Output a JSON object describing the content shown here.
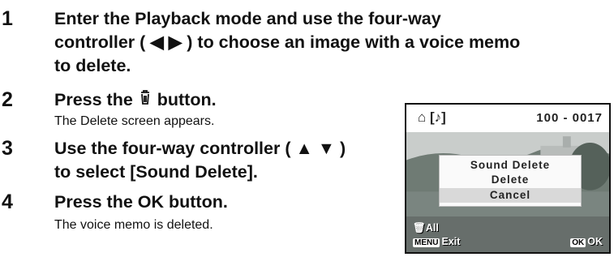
{
  "steps": [
    {
      "number": "1",
      "title_lines": [
        "Enter the Playback mode and use the four-way",
        "controller ( ◀ ▶ ) to choose an image with a voice memo",
        "to delete."
      ]
    },
    {
      "number": "2",
      "title_before": "Press the ",
      "title_icon": "trash-icon",
      "title_after": " button.",
      "desc": "The Delete screen appears."
    },
    {
      "number": "3",
      "title_lines": [
        "Use the four-way controller ( ▲ ▼ )",
        "to select [Sound Delete]."
      ]
    },
    {
      "number": "4",
      "title": "Press the OK button.",
      "desc": "The voice memo is deleted."
    }
  ],
  "camera_screen": {
    "file_number": "100 - 0017",
    "menu_items": [
      "Sound Delete",
      "Delete",
      "Cancel"
    ],
    "selected_item": "Cancel",
    "trash_all_label": "All",
    "menu_badge": "MENU",
    "menu_action": "Exit",
    "ok_badge": "OK",
    "ok_action": "OK"
  }
}
